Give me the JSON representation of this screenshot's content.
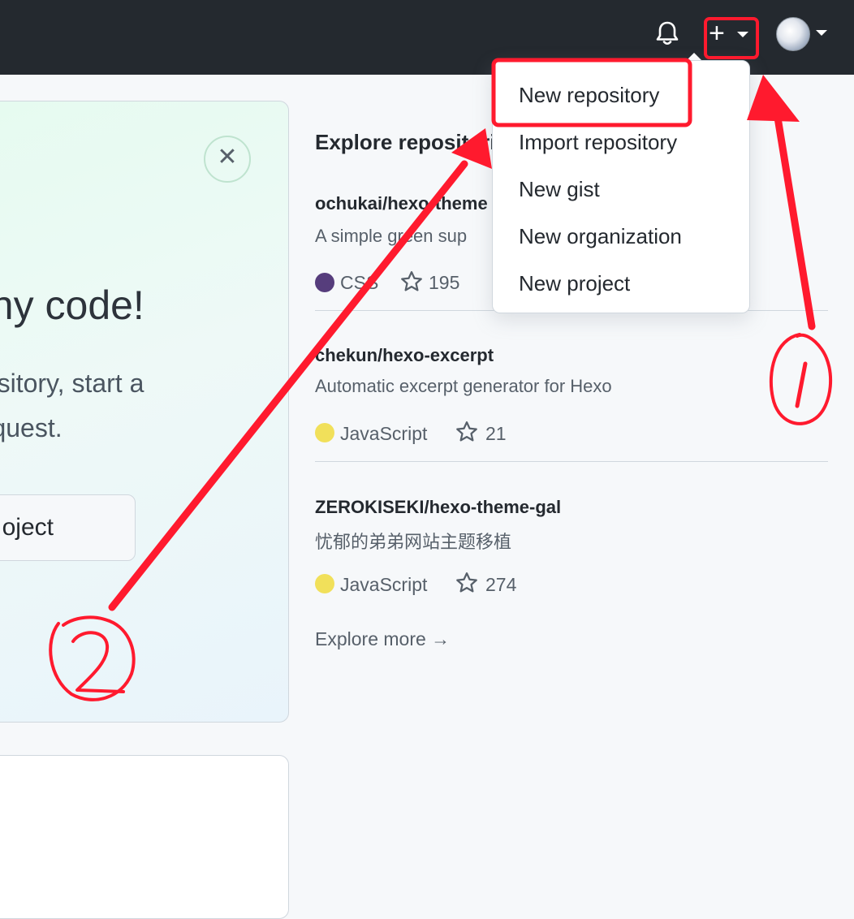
{
  "header": {
    "bell_icon": "bell-icon",
    "create_icon": "plus-icon",
    "caret_icon": "caret-down-icon",
    "avatar_icon": "avatar"
  },
  "hero": {
    "title": "any code!",
    "text_line1": "pository, start a",
    "text_line2": "request.",
    "button_label": "oject",
    "close_symbol": "✕"
  },
  "explore": {
    "title": "Explore repositories",
    "repos": [
      {
        "name": "ochukai/hexo-theme",
        "description": "A simple green sup",
        "language": "CSS",
        "language_color": "#563d7c",
        "stars": "195"
      },
      {
        "name": "chekun/hexo-excerpt",
        "description": "Automatic excerpt generator for Hexo",
        "language": "JavaScript",
        "language_color": "#f1e05a",
        "stars": "21"
      },
      {
        "name": "ZEROKISEKI/hexo-theme-gal",
        "description": "忧郁的弟弟网站主题移植",
        "language": "JavaScript",
        "language_color": "#f1e05a",
        "stars": "274"
      }
    ],
    "more_label": "Explore more →"
  },
  "create_menu": {
    "items": [
      {
        "label": "New repository"
      },
      {
        "label": "Import repository"
      },
      {
        "label": "New gist"
      },
      {
        "label": "New organization"
      },
      {
        "label": "New project"
      }
    ]
  },
  "annotations": {
    "color": "#ff1a2e",
    "step1": "1",
    "step2": "2"
  }
}
